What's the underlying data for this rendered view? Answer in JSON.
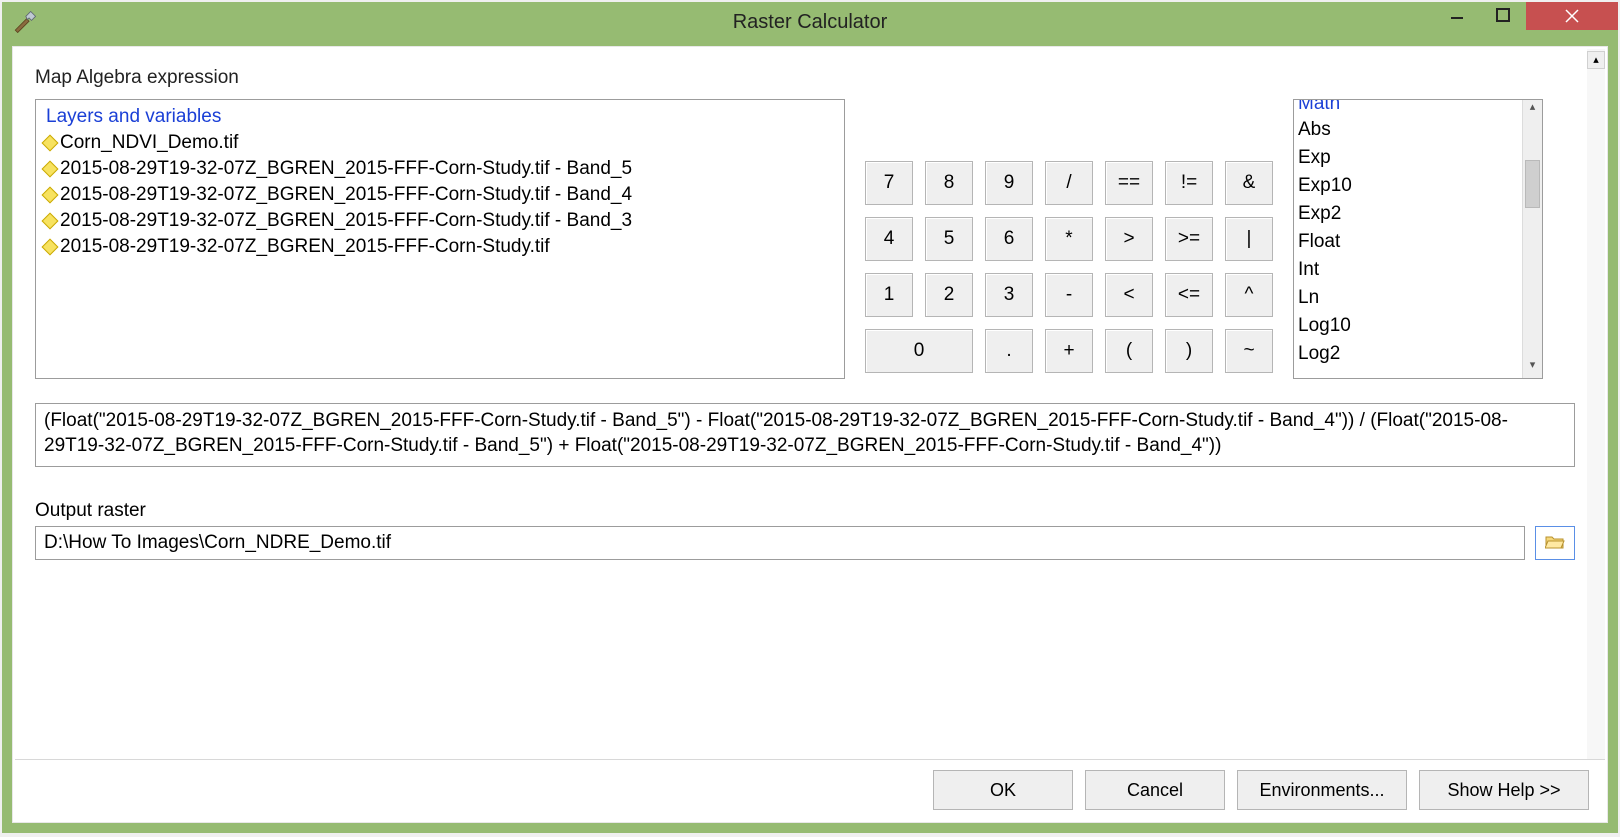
{
  "window": {
    "title": "Raster Calculator"
  },
  "labels": {
    "section": "Map Algebra expression",
    "layers_header": "Layers and variables",
    "output": "Output raster"
  },
  "layers": [
    "Corn_NDVI_Demo.tif",
    "2015-08-29T19-32-07Z_BGREN_2015-FFF-Corn-Study.tif - Band_5",
    "2015-08-29T19-32-07Z_BGREN_2015-FFF-Corn-Study.tif - Band_4",
    "2015-08-29T19-32-07Z_BGREN_2015-FFF-Corn-Study.tif - Band_3",
    "2015-08-29T19-32-07Z_BGREN_2015-FFF-Corn-Study.tif"
  ],
  "keypad": {
    "r1": [
      "7",
      "8",
      "9",
      "/",
      "==",
      "!=",
      "&"
    ],
    "r2": [
      "4",
      "5",
      "6",
      "*",
      ">",
      ">=",
      "|"
    ],
    "r3": [
      "1",
      "2",
      "3",
      "-",
      "<",
      "<=",
      "^"
    ],
    "r4_0": "0",
    "r4_rest": [
      ".",
      "+",
      "(",
      ")",
      "~"
    ]
  },
  "tools": {
    "category": "Math",
    "items": [
      "Abs",
      "Exp",
      "Exp10",
      "Exp2",
      "Float",
      "Int",
      "Ln",
      "Log10",
      "Log2"
    ]
  },
  "expression": "(Float(\"2015-08-29T19-32-07Z_BGREN_2015-FFF-Corn-Study.tif - Band_5\") - Float(\"2015-08-29T19-32-07Z_BGREN_2015-FFF-Corn-Study.tif - Band_4\")) / (Float(\"2015-08-29T19-32-07Z_BGREN_2015-FFF-Corn-Study.tif - Band_5\") + Float(\"2015-08-29T19-32-07Z_BGREN_2015-FFF-Corn-Study.tif - Band_4\"))",
  "output_path": "D:\\How To Images\\Corn_NDRE_Demo.tif",
  "footer": {
    "ok": "OK",
    "cancel": "Cancel",
    "env": "Environments...",
    "help": "Show Help >>"
  }
}
